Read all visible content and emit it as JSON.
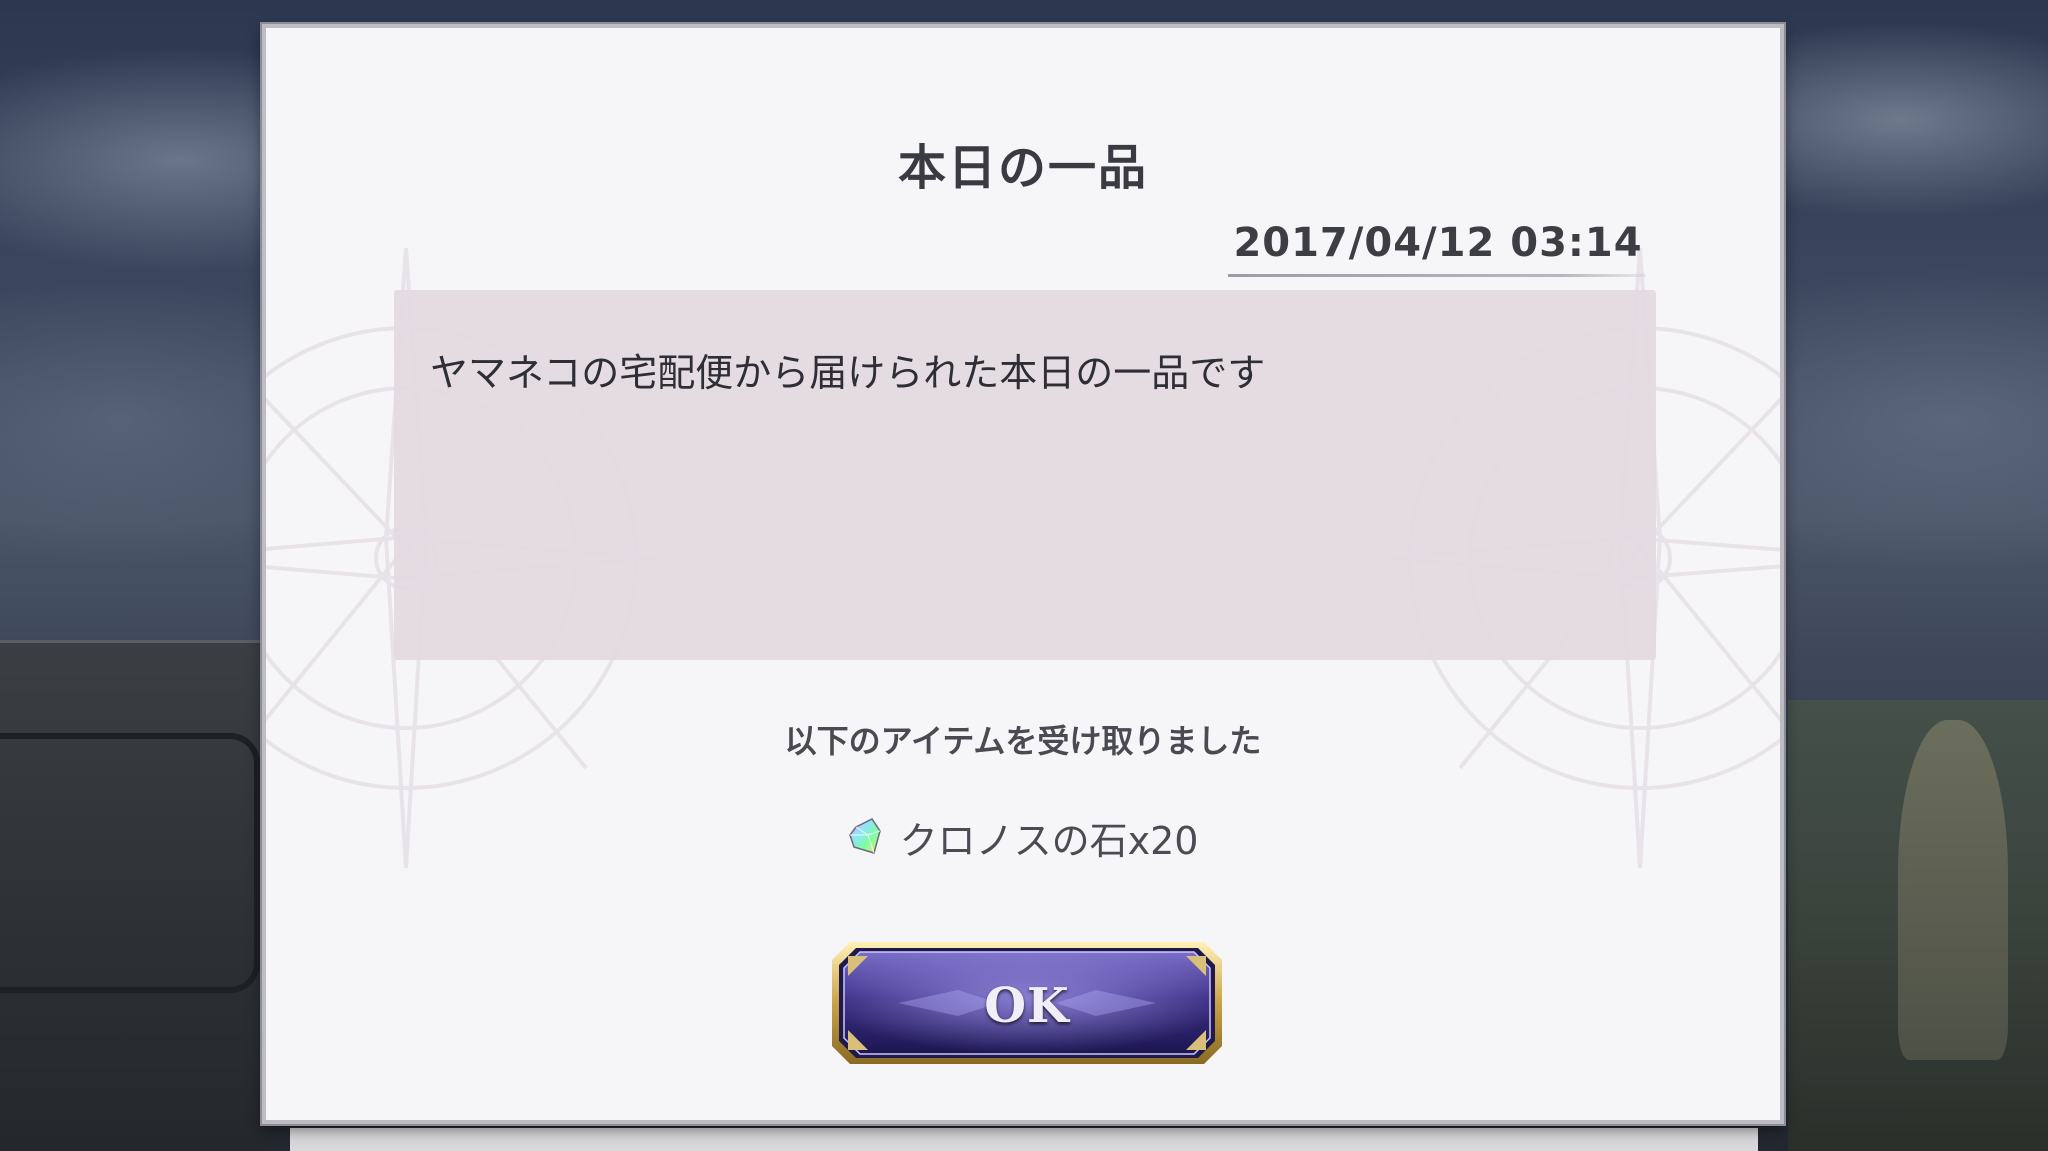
{
  "dialog": {
    "title": "本日の一品",
    "date": "2017/04/12 03:14",
    "message": "ヤマネコの宅配便から届けられた本日の一品です",
    "received_label": "以下のアイテムを受け取りました",
    "item": {
      "icon": "chronos-stone-icon",
      "name": "クロノスの石x20"
    },
    "ok_label": "OK"
  }
}
